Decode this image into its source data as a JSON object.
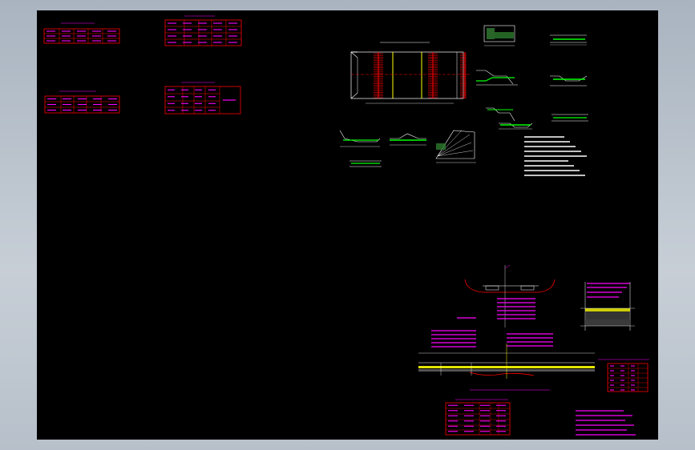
{
  "tables": {
    "t1": {
      "title": "",
      "rows": [
        [
          "",
          "",
          "",
          "",
          ""
        ],
        [
          "",
          "",
          "",
          "",
          ""
        ],
        [
          "",
          "",
          "",
          "",
          ""
        ]
      ]
    },
    "t2": {
      "title": "",
      "rows": [
        [
          "",
          "",
          "",
          "",
          ""
        ],
        [
          "",
          "",
          "",
          "",
          ""
        ],
        [
          "",
          "",
          "",
          "",
          ""
        ],
        [
          "",
          "",
          "",
          "",
          ""
        ]
      ]
    },
    "t3": {
      "title": "",
      "rows": [
        [
          "",
          "",
          "",
          "",
          ""
        ],
        [
          "",
          "",
          "",
          "",
          ""
        ],
        [
          "",
          "",
          "",
          "",
          ""
        ]
      ]
    },
    "t4": {
      "title": "",
      "rows": [
        [
          "",
          "",
          "",
          "",
          ""
        ],
        [
          "",
          "",
          "",
          "",
          ""
        ],
        [
          "",
          "",
          "",
          "",
          ""
        ],
        [
          "",
          "",
          "",
          "",
          ""
        ]
      ]
    },
    "t5": {
      "title": "",
      "rows": [
        [
          "",
          "",
          ""
        ],
        [
          "",
          "",
          ""
        ],
        [
          "",
          "",
          ""
        ],
        [
          "",
          "",
          ""
        ],
        [
          "",
          "",
          ""
        ],
        [
          "",
          "",
          ""
        ]
      ]
    },
    "t6": {
      "title": "",
      "rows": [
        [
          "",
          "",
          "",
          ""
        ],
        [
          "",
          "",
          "",
          ""
        ],
        [
          "",
          "",
          "",
          ""
        ],
        [
          "",
          "",
          "",
          ""
        ],
        [
          "",
          "",
          "",
          ""
        ]
      ]
    }
  },
  "plan": {
    "title": "",
    "dims": [
      "",
      "",
      ""
    ]
  },
  "details": {
    "labels": [
      "",
      "",
      "",
      "",
      "",
      "",
      "",
      "",
      "",
      ""
    ]
  },
  "notes": {
    "heading": "",
    "lines": [
      "",
      "",
      "",
      "",
      "",
      "",
      "",
      "",
      ""
    ]
  },
  "section": {
    "title": "",
    "sub": "",
    "dims": [
      "",
      "",
      "",
      ""
    ]
  },
  "bottom_notes": {
    "heading": "",
    "lines": [
      "",
      "",
      "",
      "",
      "",
      ""
    ]
  },
  "colors": {
    "magenta": "#ff00ff",
    "red": "#ff0000",
    "white": "#ffffff",
    "green": "#00ff00",
    "yellow": "#ffff00",
    "cyan": "#00ffff"
  }
}
